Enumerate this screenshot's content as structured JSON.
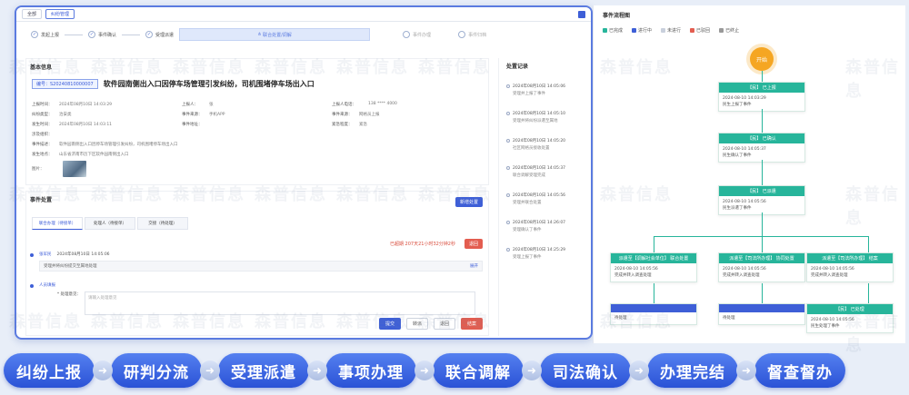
{
  "topbar": {
    "tabs": [
      "全部",
      "纠纷管理"
    ]
  },
  "steps": {
    "s1": "发起上报",
    "s2": "事件确认",
    "s3": "受理派遣",
    "highlight": "联合处置/调解",
    "s5": "事件办理",
    "s6": "事件归档"
  },
  "basic": {
    "section": "基本信息",
    "badge": "编号：S20240810000007",
    "title": "软件园南侧出入口因停车场管理引发纠纷，司机围堵停车场出入口",
    "rows": [
      [
        [
          "上报时间：",
          "2024年08月10日 14:03:29"
        ],
        [
          "上报人：",
          "张"
        ],
        [
          "上报人电话：",
          "138 **** 4000"
        ]
      ],
      [
        [
          "纠纷类型：",
          "治安类"
        ],
        [
          "事件来源：",
          "手机APP"
        ],
        [
          "事件来源：",
          "网格员上报"
        ]
      ],
      [
        [
          "发生时间：",
          "2024年08月10日 14:03:11"
        ],
        [
          "事件地址：",
          ""
        ],
        [
          "紧急程度：",
          "紧急"
        ]
      ],
      [
        [
          "涉及组织：",
          ""
        ],
        [
          "",
          ""
        ],
        [
          "",
          ""
        ]
      ],
      [
        [
          "事件描述：",
          "软件园南侧出入口因停车场管理引发纠纷，司机围堵停车场出入口"
        ],
        [
          "",
          ""
        ],
        [
          "",
          ""
        ]
      ],
      [
        [
          "发生地点：",
          "山东省济南市历下区软件园南侧出入口"
        ],
        [
          "",
          ""
        ],
        [
          "",
          ""
        ]
      ]
    ],
    "photo_label": "图片："
  },
  "disposal": {
    "section": "事件处置",
    "new_button": "新增处置",
    "tabs": [
      {
        "label": "联合办理（待接单）",
        "sub": ""
      },
      {
        "label": "处理人（待接单）",
        "sub": ""
      },
      {
        "label": "交接（待处理）",
        "sub": ""
      }
    ],
    "overdue": "已超期 207天21小时32分钟2秒",
    "overdue_button": "退回",
    "record": {
      "who": "张军民",
      "time": "2024年08月10日 14:05:06",
      "text": "受理并将纠纷提交至属地处理",
      "link": "展开"
    },
    "form_label": "人员填报",
    "form_field": "* 处理意见：",
    "form_placeholder": "请输入处理意见",
    "actions": [
      "提交",
      "转派",
      "退回",
      "结案"
    ]
  },
  "records": {
    "section": "处置记录",
    "items": [
      {
        "t": "2024年08月10日 14:05:06",
        "d": "受理并上报了事件"
      },
      {
        "t": "2024年08月10日 14:05:10",
        "d": "受理并将纠纷派遣至属地"
      },
      {
        "t": "2024年08月10日 14:05:20",
        "d": "社区网格员接收处置"
      },
      {
        "t": "2024年08月10日 14:05:37",
        "d": "联合调解受理完成"
      },
      {
        "t": "2024年08月10日 14:05:56",
        "d": "受理并联合处置"
      },
      {
        "t": "2024年08月10日 14:26:07",
        "d": "受理确认了事件"
      },
      {
        "t": "2024年08月10日 14:25:29",
        "d": "受理上报了事件"
      }
    ]
  },
  "flow": {
    "title": "事件流程图",
    "legend": [
      "已完成",
      "进行中",
      "未进行",
      "已驳回",
      "已终止"
    ],
    "legend_colors": [
      "#27b59b",
      "#3e5fd7",
      "#c9d0dc",
      "#e35d50",
      "#999999"
    ],
    "start": "开始",
    "n1": {
      "h": "【民】 已上报",
      "b1": "2024-08-10 14:03:29",
      "b2": "民生上报了事件"
    },
    "n2": {
      "h": "【民】 已确认",
      "b1": "2024-08-10 14:05:37",
      "b2": "民生确认了事件"
    },
    "n3": {
      "h": "【民】 已派遣",
      "b1": "2024-08-10 14:05:56",
      "b2": "民生派遣了事件"
    },
    "n4": {
      "h": "派遣至【调解社会单位】 联合处置",
      "b1": "2024-08-10 14:05:56",
      "b2": "完成并转入调查处理"
    },
    "n5": {
      "h": "派遣至【司法所办理】 协同处置",
      "b1": "2024-08-10 14:05:56",
      "b2": "完成并转入调查处理"
    },
    "n6": {
      "h": "派遣至【司法所办理】 结案",
      "b1": "2024-08-10 14:05:56",
      "b2": "完成并转入调查处理"
    },
    "n7": {
      "h": "",
      "b1": "待处理",
      "b2": ""
    },
    "n8": {
      "h": "",
      "b1": "待处理",
      "b2": ""
    },
    "n9": {
      "h": "【民】 已处理",
      "b1": "2024-08-10 14:05:56",
      "b2": "民生处理了事件"
    }
  },
  "watermark": "森普信息",
  "pipeline": [
    "纠纷上报",
    "研判分流",
    "受理派遣",
    "事项办理",
    "联合调解",
    "司法确认",
    "办理完结",
    "督查督办"
  ]
}
